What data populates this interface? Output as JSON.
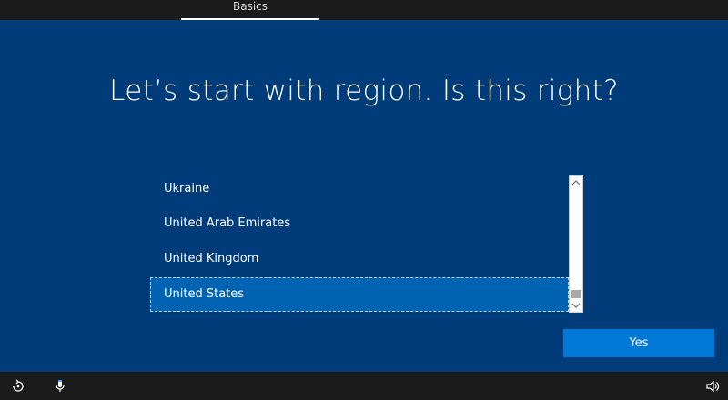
{
  "header": {
    "tab_label": "Basics"
  },
  "main": {
    "title": "Let’s start with region. Is this right?",
    "region_list": {
      "items": [
        {
          "label": "Ukraine",
          "selected": false
        },
        {
          "label": "United Arab Emirates",
          "selected": false
        },
        {
          "label": "United Kingdom",
          "selected": false
        },
        {
          "label": "United States",
          "selected": true
        }
      ]
    },
    "yes_button_label": "Yes"
  },
  "bottombar": {
    "icons": [
      "ease-of-access-icon",
      "microphone-icon",
      "volume-icon"
    ]
  },
  "colors": {
    "background": "#003b7a",
    "accent_button": "#0078d7",
    "selected_item": "#0063b1",
    "bar": "#1b1b1b"
  }
}
